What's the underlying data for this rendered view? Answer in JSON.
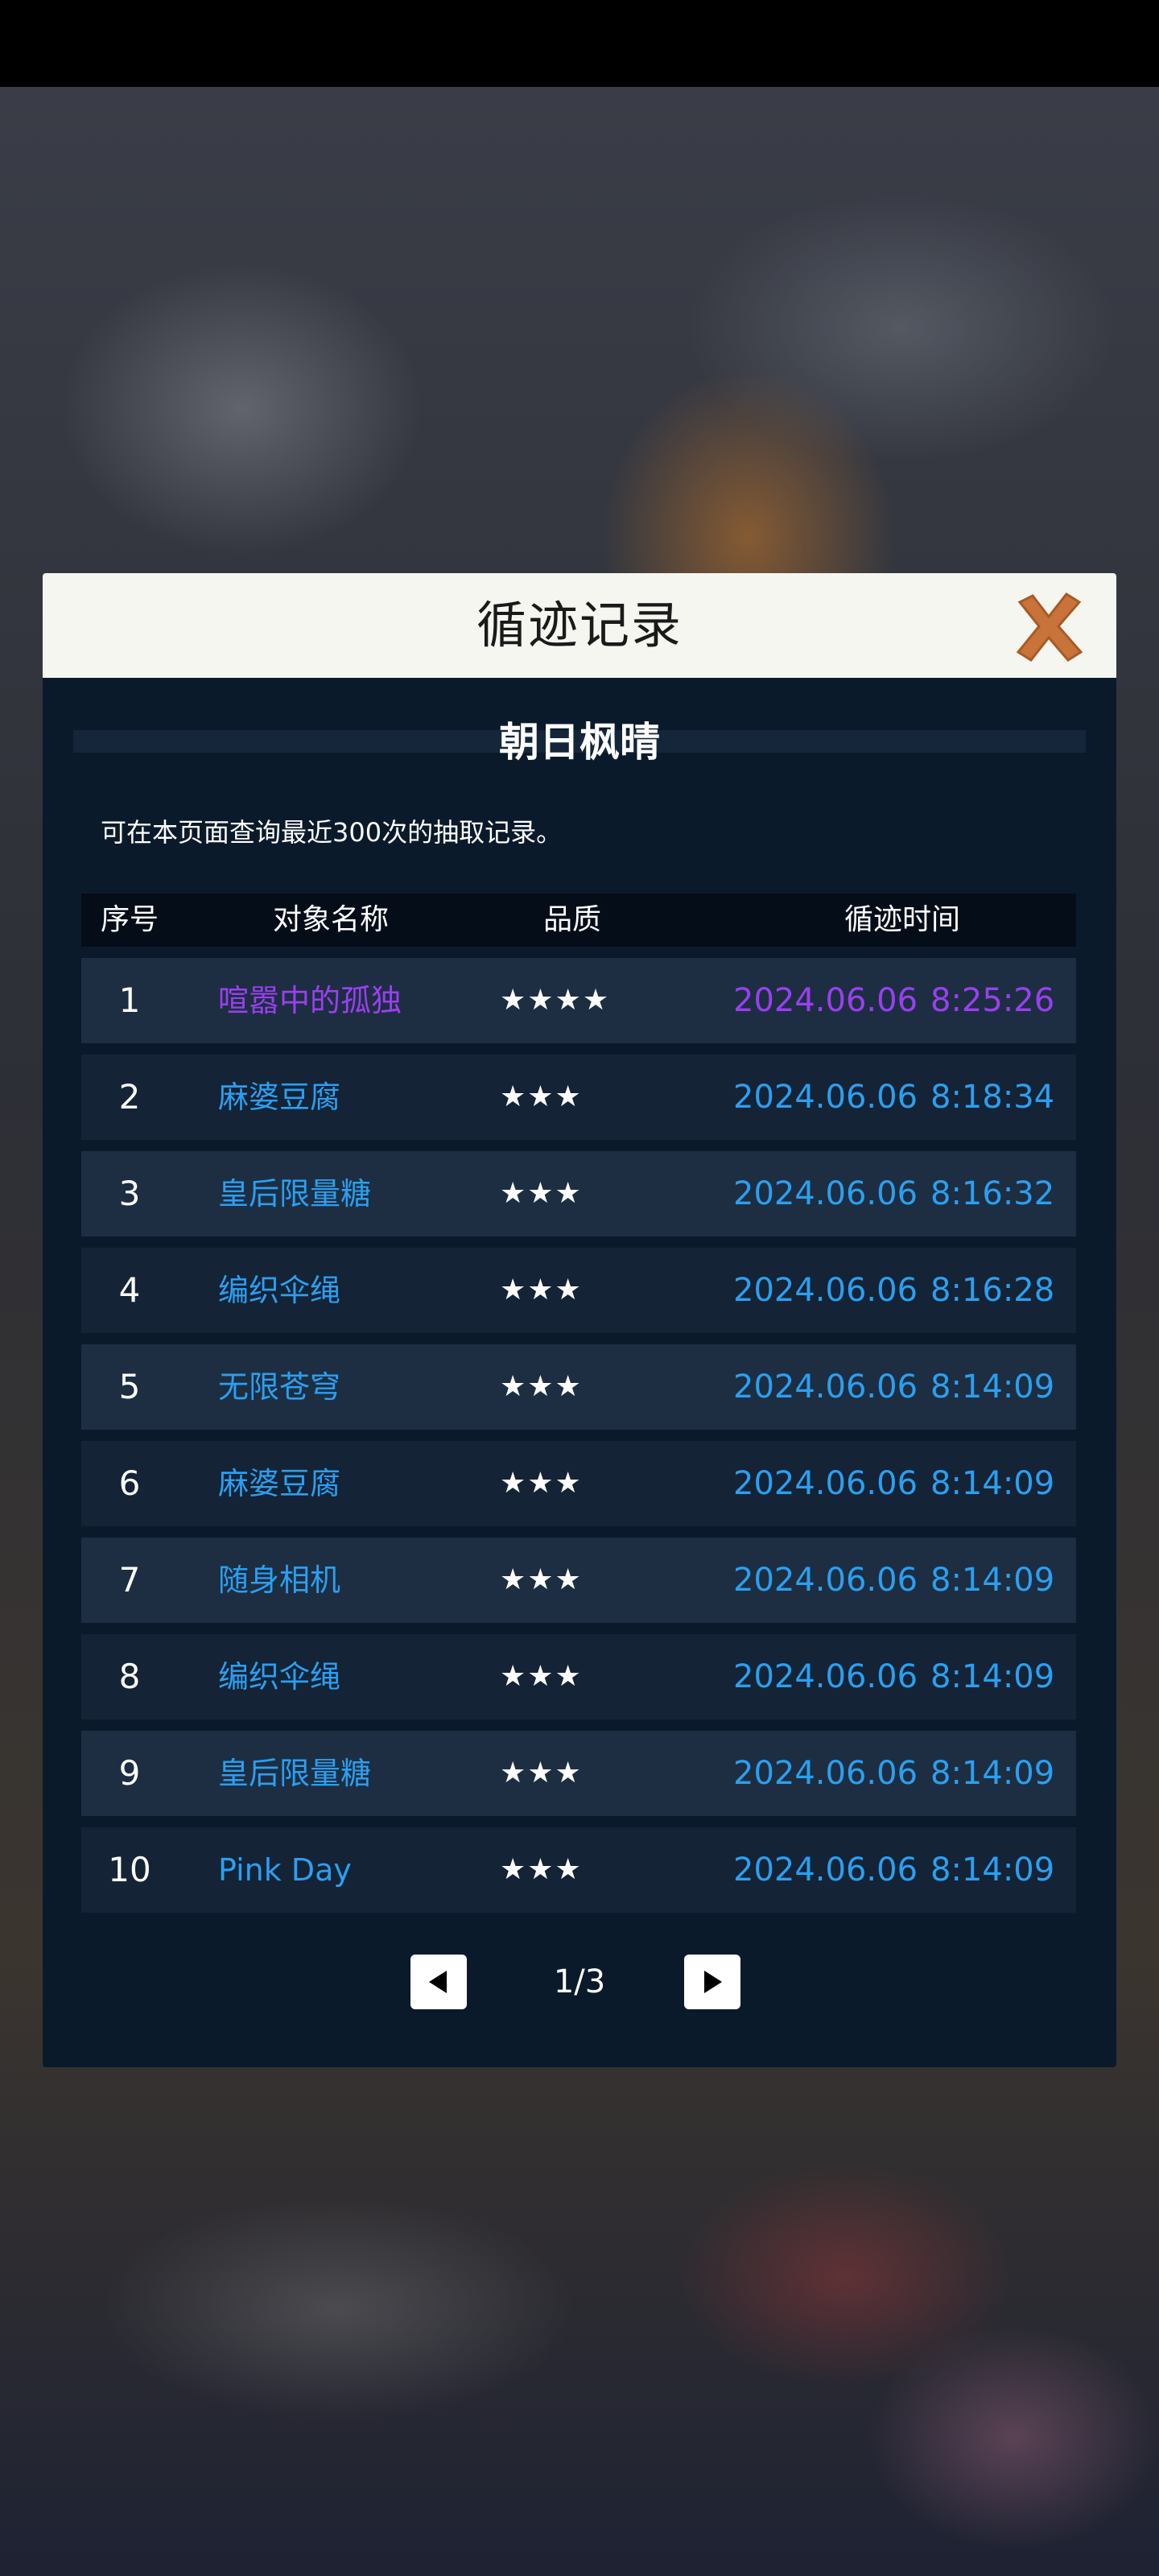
{
  "dialog": {
    "title": "循迹记录",
    "subtitle": "朝日枫晴",
    "notice": "可在本页面查询最近300次的抽取记录。"
  },
  "table": {
    "headers": [
      "序号",
      "对象名称",
      "品质",
      "循迹时间"
    ],
    "rows": [
      {
        "index": "1",
        "name": "喧嚣中的孤独",
        "stars": "★★★★",
        "date": "2024.06.06",
        "time": "8:25:26",
        "color": "#9a3ff0"
      },
      {
        "index": "2",
        "name": "麻婆豆腐",
        "stars": "★★★",
        "date": "2024.06.06",
        "time": "8:18:34",
        "color": "#2b9ff0"
      },
      {
        "index": "3",
        "name": "皇后限量糖",
        "stars": "★★★",
        "date": "2024.06.06",
        "time": "8:16:32",
        "color": "#2b9ff0"
      },
      {
        "index": "4",
        "name": "编织伞绳",
        "stars": "★★★",
        "date": "2024.06.06",
        "time": "8:16:28",
        "color": "#2b9ff0"
      },
      {
        "index": "5",
        "name": "无限苍穹",
        "stars": "★★★",
        "date": "2024.06.06",
        "time": "8:14:09",
        "color": "#2b9ff0"
      },
      {
        "index": "6",
        "name": "麻婆豆腐",
        "stars": "★★★",
        "date": "2024.06.06",
        "time": "8:14:09",
        "color": "#2b9ff0"
      },
      {
        "index": "7",
        "name": "随身相机",
        "stars": "★★★",
        "date": "2024.06.06",
        "time": "8:14:09",
        "color": "#2b9ff0"
      },
      {
        "index": "8",
        "name": "编织伞绳",
        "stars": "★★★",
        "date": "2024.06.06",
        "time": "8:14:09",
        "color": "#2b9ff0"
      },
      {
        "index": "9",
        "name": "皇后限量糖",
        "stars": "★★★",
        "date": "2024.06.06",
        "time": "8:14:09",
        "color": "#2b9ff0"
      },
      {
        "index": "10",
        "name": "Pink Day",
        "stars": "★★★",
        "date": "2024.06.06",
        "time": "8:14:09",
        "color": "#2b9ff0"
      }
    ]
  },
  "pager": {
    "label": "1/3",
    "prev_icon": "triangle-left-icon",
    "next_icon": "triangle-right-icon"
  },
  "colors": {
    "accent_close": "#c8733a",
    "blue_item": "#2b9ff0",
    "purple_item": "#9a3ff0",
    "panel_bg": "#0b1a2b"
  }
}
